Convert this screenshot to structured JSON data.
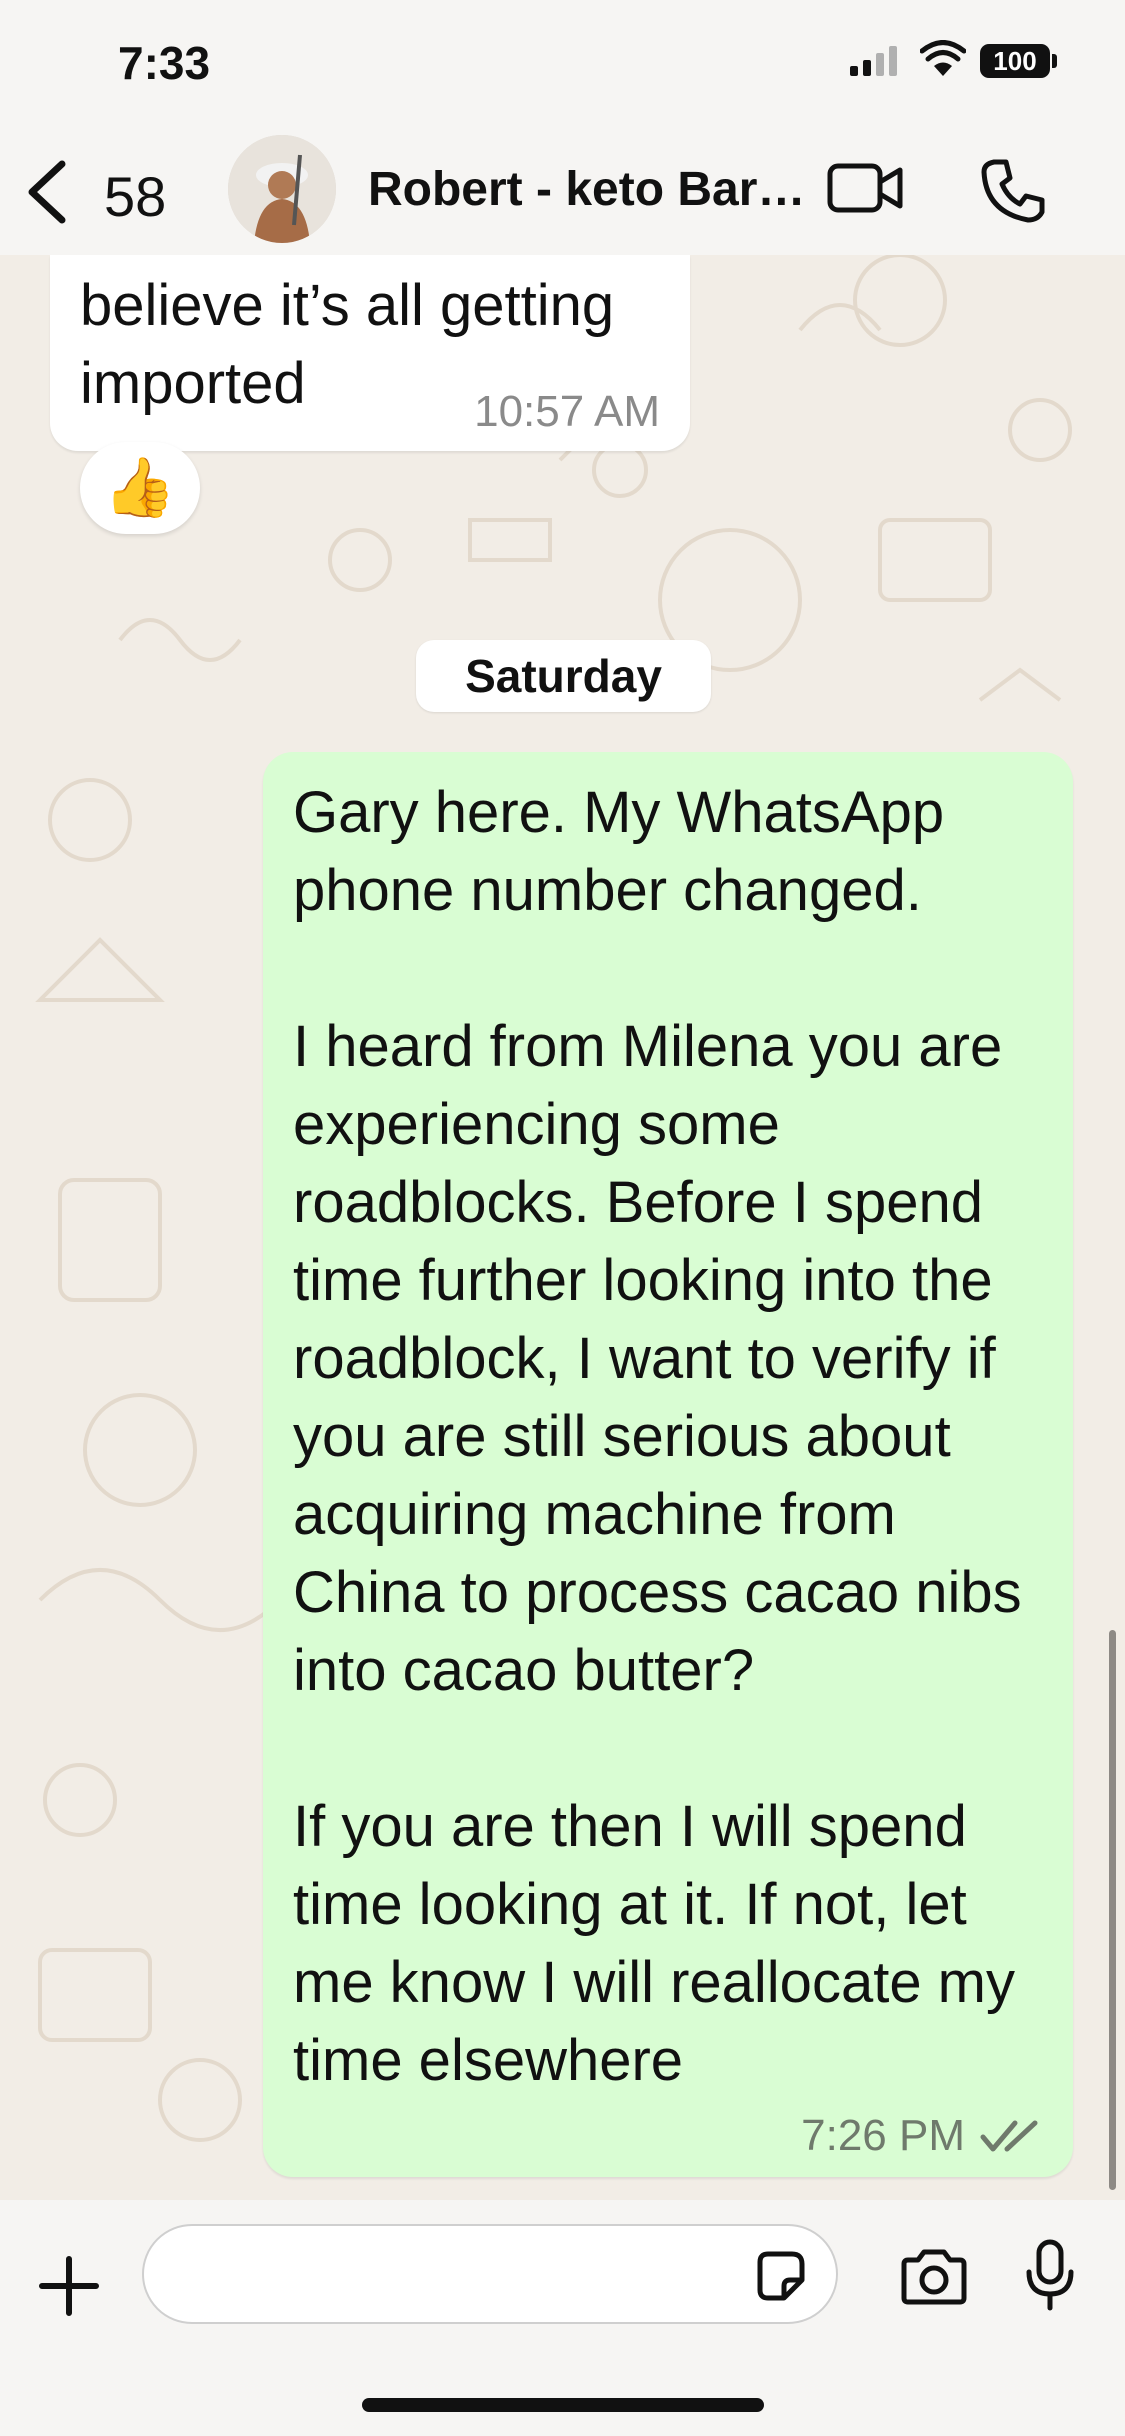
{
  "status_bar": {
    "time": "7:33",
    "battery": "100"
  },
  "header": {
    "back_count": "58",
    "contact_name": "Robert - keto Bar…"
  },
  "messages": {
    "incoming": {
      "text": "believe it’s all getting imported",
      "time": "10:57 AM",
      "reaction": "👍"
    },
    "day_separator": "Saturday",
    "outgoing": {
      "text": "Gary here. My WhatsApp phone number changed.\n\nI heard from Milena you are experiencing some roadblocks. Before I spend time further looking into the roadblock, I want to verify if you are still serious about acquiring machine from China to process cacao nibs into cacao butter?\n\nIf you are then I will spend time looking at it. If not, let me know I will reallocate my time elsewhere",
      "time": "7:26 PM",
      "status": "read"
    }
  },
  "composer": {
    "value": "",
    "placeholder": ""
  },
  "colors": {
    "outgoing_bubble": "#d9fdd3",
    "incoming_bubble": "#ffffff",
    "wallpaper": "#f2ede6"
  }
}
